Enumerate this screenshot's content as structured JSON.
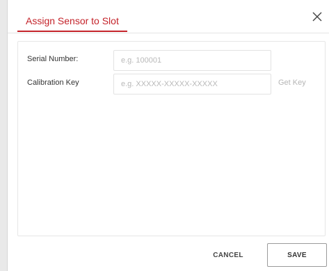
{
  "dialog": {
    "title": "Assign Sensor to Slot",
    "close_icon": "close-icon"
  },
  "form": {
    "serial_number": {
      "label": "Serial Number:",
      "value": "",
      "placeholder": "e.g. 100001"
    },
    "calibration_key": {
      "label": "Calibration Key",
      "value": "",
      "placeholder": "e.g. XXXXX-XXXXX-XXXXX",
      "get_key_label": "Get Key"
    }
  },
  "footer": {
    "cancel_label": "CANCEL",
    "save_label": "SAVE"
  },
  "colors": {
    "accent": "#c4232a",
    "text": "#333333",
    "placeholder": "#b9b9b9",
    "muted_link": "#b5b5b5",
    "border": "#e2e2e2"
  }
}
